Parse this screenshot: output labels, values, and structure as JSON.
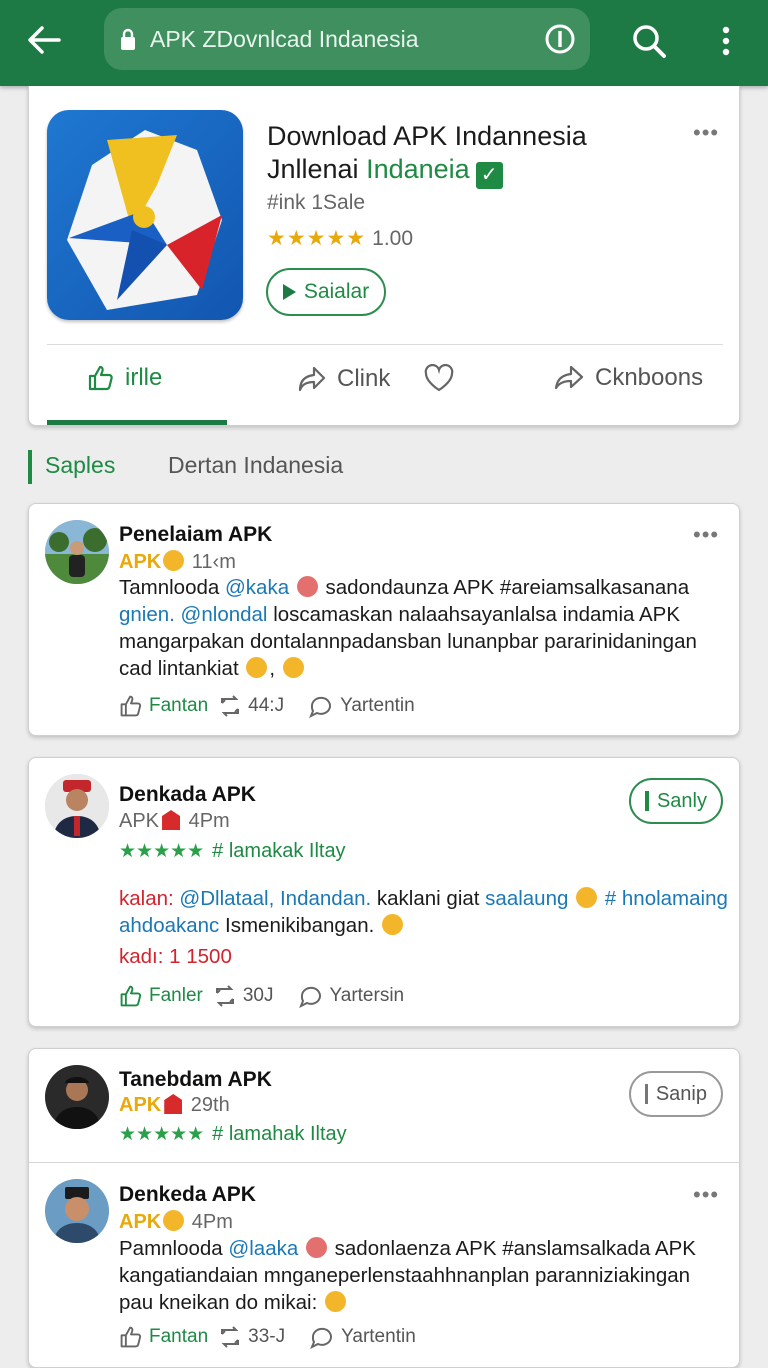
{
  "browser": {
    "url": "APK ZDovnlcad Indanesia"
  },
  "app": {
    "title_line1": "Download APK Indannesia",
    "title_line2_a": "Jnllenai",
    "title_line2_b": "Indaneia",
    "check": "✓",
    "meta": "#ink 1Sale",
    "stars": "★★★★★",
    "rating": "1.00",
    "install_label": "Saialar",
    "more": "•••"
  },
  "actions": [
    {
      "label": "irlle",
      "icon": "thumbs-up-icon"
    },
    {
      "label": "Clink",
      "icon": "share-icon"
    },
    {
      "label": "",
      "icon": "heart-icon"
    },
    {
      "label": "Cknboons",
      "icon": "forward-icon"
    }
  ],
  "tabs": [
    {
      "label": "Saples"
    },
    {
      "label": "Dertan  Indanesia"
    }
  ],
  "posts": [
    {
      "name": "Penelaiam APK",
      "badge": "APK",
      "time": "11‹m",
      "more": "•••",
      "line1_a": "Tamnlooda",
      "line1_mention": "@kaka",
      "line1_b": "sadondaunza APK #areiamsalkasanana",
      "line2_mention": "gnien. @nlondal",
      "line2_b": "loscamaskan nalaahsayanlalsa indamia APK",
      "line3": "mangarpakan dontalannpadansban lunanpbar pararinidaningan",
      "line4": "cad lintankiat",
      "like": "Fantan",
      "repost": "44:J",
      "comment": "Yartentin"
    },
    {
      "name": "Denkada APK",
      "badge": "APK",
      "time": "4Pm",
      "stars": "★★★★★",
      "hashtag": "# lamakak Iltay",
      "follow": "Sanly",
      "line1_red": "kalan:",
      "line1_mention": "@Dllataal, Indandan.",
      "line1_b": "kaklani giat",
      "line1_blue": "saalaung",
      "line1_tag": "# hnolamaing",
      "line2_blue": "ahdoakanc",
      "line2_b": "Ismenikibangan.",
      "line3": "kadı: 1 1500",
      "like": "Fanler",
      "repost": "30J",
      "comment": "Yartersin"
    },
    {
      "name": "Tanebdam APK",
      "badge": "APK",
      "time": "29th",
      "stars": "★★★★★",
      "hashtag": "# lamahak Iltay",
      "follow": "Sanip"
    },
    {
      "name": "Denkeda APK",
      "badge": "APK",
      "time": "4Pm",
      "more": "•••",
      "line1_a": "Pamnlooda",
      "line1_mention": "@laaka",
      "line1_b": "sadonlaenza APK #anslamsalkada APK",
      "line2": "kangatiandaian mnganeperlenstaahhnanplan paranniziakingan",
      "line3": "pau kneikan do mikai:",
      "like": "Fantan",
      "repost": "33-J",
      "comment": "Yartentin"
    }
  ],
  "colors": {
    "brand_green": "#1e7a45",
    "accent_green": "#1e8a44",
    "star_gold": "#e8a90a",
    "mention_blue": "#1a78b5"
  }
}
